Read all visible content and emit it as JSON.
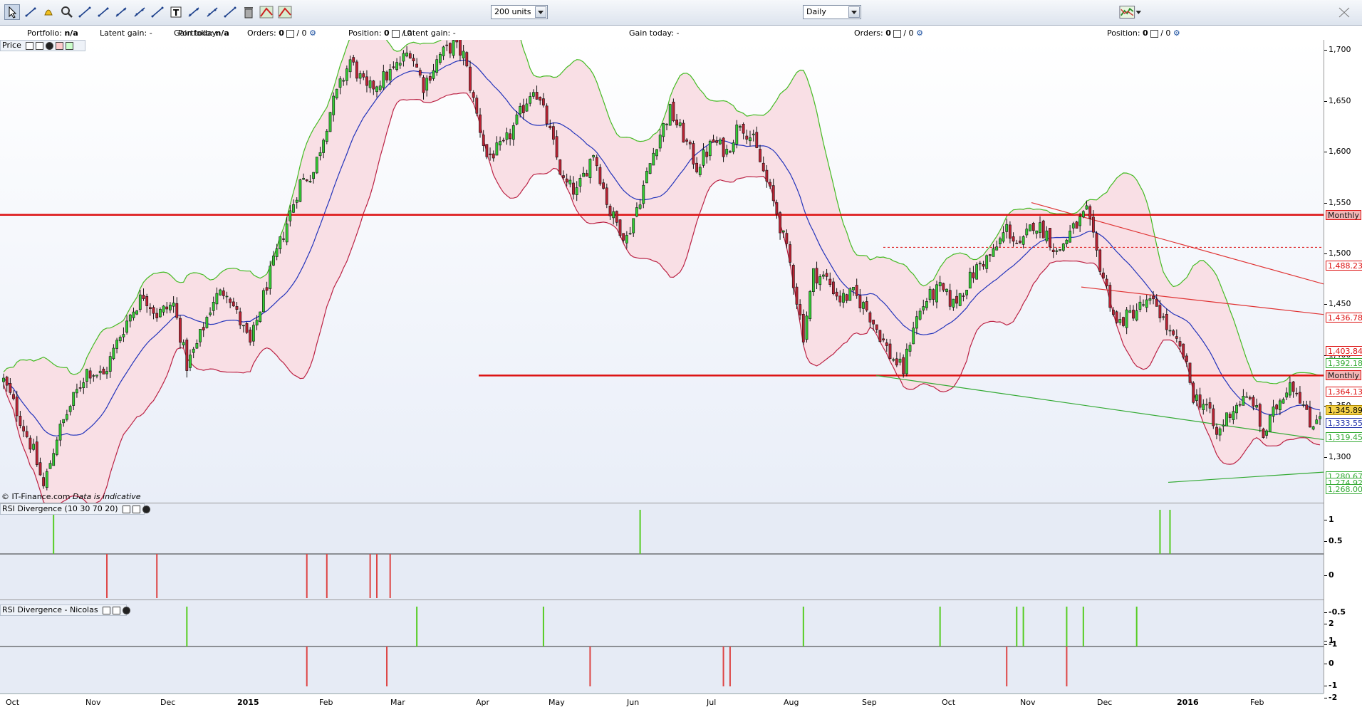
{
  "toolbar": {
    "tools": [
      "pointer-icon",
      "ruler-icon",
      "alarm-bell-icon",
      "zoom-icon",
      "line-icon",
      "ray-icon",
      "horizontal-line-icon",
      "vertical-line-icon",
      "fibonacci-icon",
      "text-icon",
      "channel-icon",
      "fan-icon",
      "hammer-icon",
      "trash-icon",
      "triangle-icon",
      "wedge-icon"
    ],
    "units_select": "200 units",
    "period_select": "Daily"
  },
  "infobar": {
    "portfolio_label": "Portfolio:",
    "portfolio_value": "n/a",
    "latent_gain_label": "Latent gain:",
    "latent_gain_value": "-",
    "gain_today_label": "Gain today:",
    "gain_today_value": "-",
    "orders_label": "Orders:",
    "orders_value": "0",
    "orders_slash": "/ 0",
    "position_label": "Position:",
    "position_value": "0",
    "position_slash": "/ 0",
    "overlap_text1": "Portfolio:",
    "overlap_text2": "n/a",
    "overlap_text3": "Latent gain:",
    "overlap_text4": "-"
  },
  "price_panel": {
    "label": "Price",
    "copyright": "© IT-Finance.com",
    "disclaimer": "Data is indicative",
    "y_ticks": [
      "1,700",
      "1,650",
      "1,600",
      "1,550",
      "1,500",
      "1,450",
      "1,400",
      "1,350",
      "1,300"
    ],
    "price_tags": [
      {
        "text": "Monthly",
        "color": "#dd1111",
        "value": 1538
      },
      {
        "text": "1,488.23",
        "color": "#dd1111",
        "value": 1488.23
      },
      {
        "text": "1,436.78",
        "color": "#dd1111",
        "value": 1436.78
      },
      {
        "text": "1,403.84",
        "color": "#dd1111",
        "value": 1403.84
      },
      {
        "text": "1,392.18",
        "color": "#33aa33",
        "value": 1392.18
      },
      {
        "text": "Monthly",
        "color": "#dd1111",
        "value": 1380
      },
      {
        "text": "1,364.13",
        "color": "#dd1111",
        "value": 1364.13
      },
      {
        "text": "1,345.89",
        "color": "#000000",
        "value": 1345.89
      },
      {
        "text": "1,333.55",
        "color": "#2233aa",
        "value": 1333.55
      },
      {
        "text": "1,319.45",
        "color": "#33aa33",
        "value": 1319.45
      },
      {
        "text": "1,280.67",
        "color": "#33aa33",
        "value": 1280.67
      },
      {
        "text": "1,274.92",
        "color": "#33aa33",
        "value": 1274.92
      },
      {
        "text": "1,268.00",
        "color": "#33aa33",
        "value": 1268
      }
    ]
  },
  "rsi1_panel": {
    "label": "RSI Divergence (10 30 70 20)",
    "y_ticks": [
      "1",
      "0.5",
      "0",
      "-0.5",
      "-1"
    ]
  },
  "rsi2_panel": {
    "label": "RSI Divergence - Nicolas",
    "y_ticks": [
      "2",
      "1",
      "0",
      "-1",
      "-2"
    ]
  },
  "x_axis": {
    "months": [
      {
        "label": "Oct",
        "bold": false
      },
      {
        "label": "Nov",
        "bold": false
      },
      {
        "label": "Dec",
        "bold": false
      },
      {
        "label": "2015",
        "bold": true
      },
      {
        "label": "Feb",
        "bold": false
      },
      {
        "label": "Mar",
        "bold": false
      },
      {
        "label": "Apr",
        "bold": false
      },
      {
        "label": "May",
        "bold": false
      },
      {
        "label": "Jun",
        "bold": false
      },
      {
        "label": "Jul",
        "bold": false
      },
      {
        "label": "Aug",
        "bold": false
      },
      {
        "label": "Sep",
        "bold": false
      },
      {
        "label": "Oct",
        "bold": false
      },
      {
        "label": "Nov",
        "bold": false
      },
      {
        "label": "Dec",
        "bold": false
      },
      {
        "label": "2016",
        "bold": true
      },
      {
        "label": "Feb",
        "bold": false
      }
    ]
  },
  "chart_data": {
    "type": "candlestick",
    "ylim": [
      1255,
      1710
    ],
    "horizontal_levels": [
      1538,
      1380
    ],
    "anchors": [
      [
        0,
        1375
      ],
      [
        4,
        1345
      ],
      [
        9,
        1305
      ],
      [
        12,
        1270
      ],
      [
        16,
        1320
      ],
      [
        20,
        1350
      ],
      [
        25,
        1385
      ],
      [
        30,
        1380
      ],
      [
        35,
        1420
      ],
      [
        38,
        1440
      ],
      [
        42,
        1460
      ],
      [
        46,
        1440
      ],
      [
        51,
        1450
      ],
      [
        55,
        1390
      ],
      [
        58,
        1410
      ],
      [
        63,
        1455
      ],
      [
        67,
        1465
      ],
      [
        70,
        1440
      ],
      [
        74,
        1410
      ],
      [
        79,
        1470
      ],
      [
        85,
        1530
      ],
      [
        89,
        1570
      ],
      [
        93,
        1580
      ],
      [
        98,
        1640
      ],
      [
        104,
        1690
      ],
      [
        109,
        1660
      ],
      [
        113,
        1670
      ],
      [
        117,
        1680
      ],
      [
        122,
        1700
      ],
      [
        126,
        1665
      ],
      [
        131,
        1695
      ],
      [
        135,
        1705
      ],
      [
        138,
        1695
      ],
      [
        141,
        1650
      ],
      [
        145,
        1595
      ],
      [
        150,
        1605
      ],
      [
        154,
        1630
      ],
      [
        159,
        1665
      ],
      [
        163,
        1630
      ],
      [
        168,
        1570
      ],
      [
        172,
        1560
      ],
      [
        177,
        1600
      ],
      [
        182,
        1540
      ],
      [
        187,
        1515
      ],
      [
        191,
        1555
      ],
      [
        196,
        1610
      ],
      [
        200,
        1640
      ],
      [
        204,
        1615
      ],
      [
        208,
        1585
      ],
      [
        213,
        1610
      ],
      [
        217,
        1600
      ],
      [
        221,
        1630
      ],
      [
        225,
        1610
      ],
      [
        228,
        1580
      ],
      [
        232,
        1540
      ],
      [
        236,
        1490
      ],
      [
        240,
        1420
      ],
      [
        243,
        1480
      ],
      [
        247,
        1475
      ],
      [
        251,
        1455
      ],
      [
        255,
        1460
      ],
      [
        259,
        1445
      ],
      [
        263,
        1420
      ],
      [
        266,
        1400
      ],
      [
        270,
        1385
      ],
      [
        273,
        1430
      ],
      [
        277,
        1455
      ],
      [
        281,
        1465
      ],
      [
        285,
        1450
      ],
      [
        289,
        1470
      ],
      [
        293,
        1490
      ],
      [
        297,
        1500
      ],
      [
        301,
        1525
      ],
      [
        305,
        1505
      ],
      [
        309,
        1530
      ],
      [
        313,
        1520
      ],
      [
        316,
        1500
      ],
      [
        320,
        1520
      ],
      [
        325,
        1540
      ],
      [
        328,
        1500
      ],
      [
        331,
        1465
      ],
      [
        334,
        1430
      ],
      [
        338,
        1440
      ],
      [
        342,
        1450
      ],
      [
        346,
        1450
      ],
      [
        350,
        1420
      ],
      [
        354,
        1400
      ],
      [
        357,
        1360
      ],
      [
        361,
        1350
      ],
      [
        364,
        1320
      ],
      [
        367,
        1340
      ],
      [
        371,
        1355
      ],
      [
        375,
        1355
      ],
      [
        378,
        1320
      ],
      [
        382,
        1350
      ],
      [
        386,
        1375
      ],
      [
        389,
        1360
      ],
      [
        392,
        1330
      ],
      [
        395,
        1345
      ]
    ],
    "rsi1_signals": {
      "positive": [
        15,
        191,
        347,
        350
      ],
      "negative": [
        31,
        46,
        91,
        97,
        110,
        112,
        116
      ]
    },
    "rsi2_signals": {
      "positive": [
        55,
        124,
        162,
        240,
        281,
        304,
        306,
        319,
        324,
        340
      ],
      "negative": [
        91,
        115,
        176,
        216,
        218,
        301,
        319
      ]
    }
  }
}
